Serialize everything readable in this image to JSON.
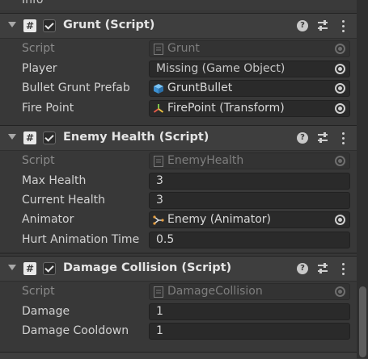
{
  "top_clipped_text": "Info",
  "components": [
    {
      "title": "Grunt (Script)",
      "rows": [
        {
          "label": "Script",
          "value": "Grunt",
          "readonly": true,
          "icon": "script-icon"
        },
        {
          "label": "Player",
          "value": "Missing (Game Object)",
          "readonly": false,
          "icon": "none"
        },
        {
          "label": "Bullet Grunt Prefab",
          "value": "GruntBullet",
          "readonly": false,
          "icon": "prefab-cube-icon"
        },
        {
          "label": "Fire Point",
          "value": "FirePoint (Transform)",
          "readonly": false,
          "icon": "transform-icon"
        }
      ]
    },
    {
      "title": "Enemy Health (Script)",
      "rows": [
        {
          "label": "Script",
          "value": "EnemyHealth",
          "readonly": true,
          "icon": "script-icon"
        },
        {
          "label": "Max Health",
          "value": "3"
        },
        {
          "label": "Current Health",
          "value": "3"
        },
        {
          "label": "Animator",
          "value": "Enemy (Animator)",
          "icon": "animator-icon"
        },
        {
          "label": "Hurt Animation Time",
          "value": "0.5"
        }
      ]
    },
    {
      "title": "Damage Collision (Script)",
      "rows": [
        {
          "label": "Script",
          "value": "DamageCollision",
          "readonly": true,
          "icon": "script-icon"
        },
        {
          "label": "Damage",
          "value": "1"
        },
        {
          "label": "Damage Cooldown",
          "value": "1"
        }
      ]
    }
  ],
  "colors": {
    "background": "#383838",
    "header": "#3e3e3e",
    "field": "#2a2a2a",
    "text": "#d2d2d2",
    "dim_text": "#8a8a8a",
    "prefab_blue": "#4fa8e8"
  }
}
